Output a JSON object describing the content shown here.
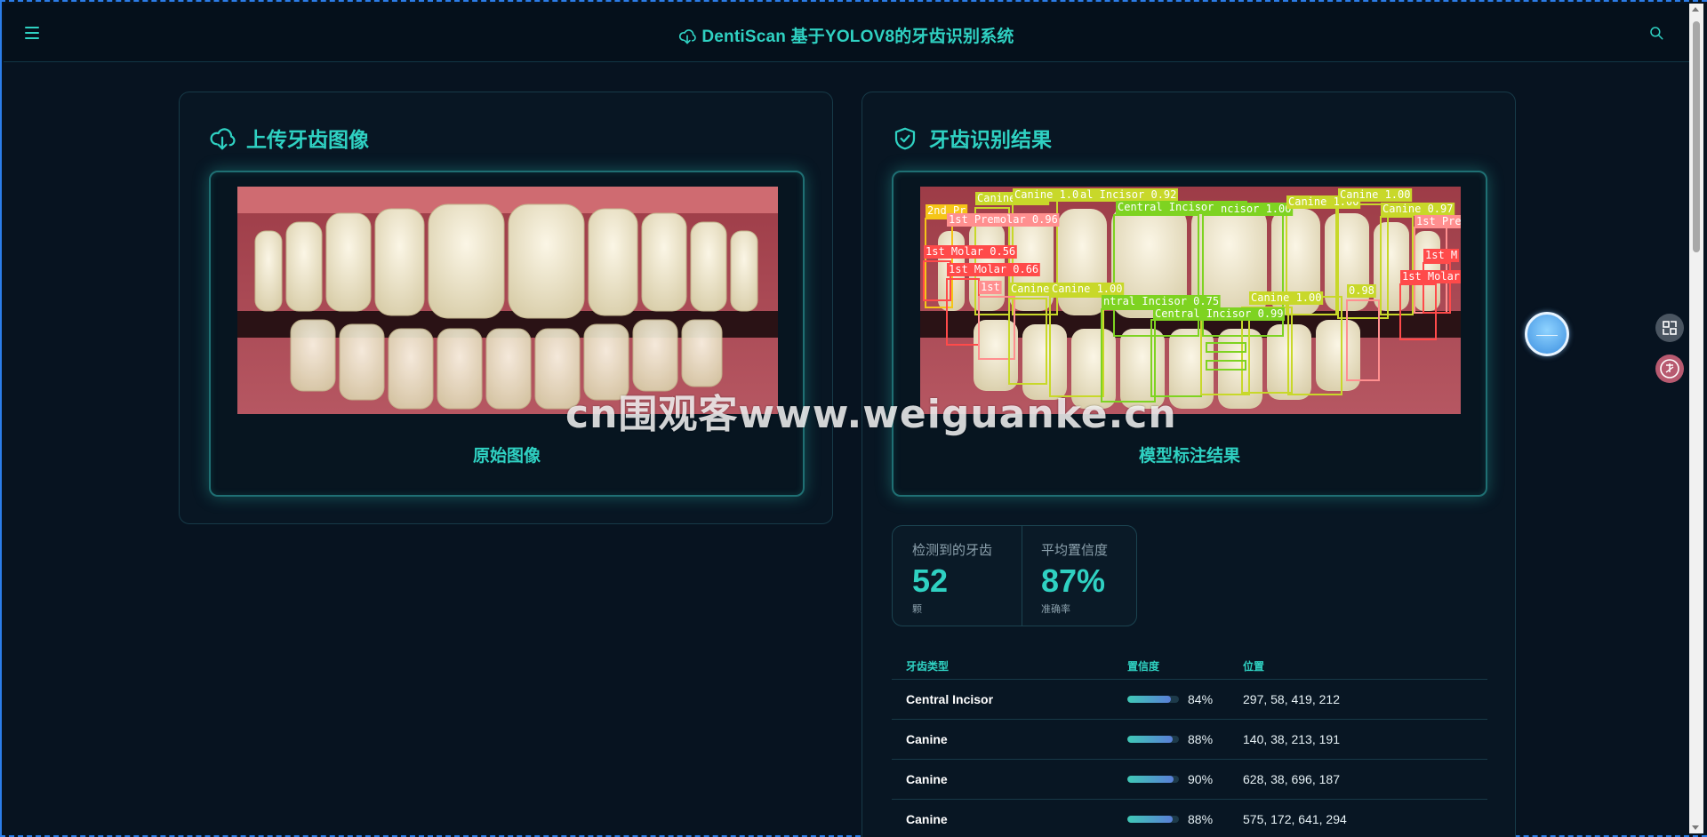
{
  "header": {
    "title": "DentiScan 基于YOLOV8的牙齿识别系统"
  },
  "upload_panel": {
    "title": "上传牙齿图像",
    "caption": "原始图像"
  },
  "result_panel": {
    "title": "牙齿识别结果",
    "caption": "模型标注结果"
  },
  "stats": {
    "detected": {
      "label": "检测到的牙齿",
      "value": "52",
      "unit": "颗"
    },
    "confidence": {
      "label": "平均置信度",
      "value": "87%",
      "unit": "准确率"
    }
  },
  "table": {
    "headers": {
      "type": "牙齿类型",
      "confidence": "置信度",
      "position": "位置"
    },
    "rows": [
      {
        "type": "Central Incisor",
        "confidence": 84,
        "confidence_text": "84%",
        "position": "297, 58, 419, 212"
      },
      {
        "type": "Canine",
        "confidence": 88,
        "confidence_text": "88%",
        "position": "140, 38, 213, 191"
      },
      {
        "type": "Canine",
        "confidence": 90,
        "confidence_text": "90%",
        "position": "628, 38, 696, 187"
      },
      {
        "type": "Canine",
        "confidence": 88,
        "confidence_text": "88%",
        "position": "575, 172, 641, 294"
      }
    ]
  },
  "detection_labels": [
    {
      "text": "2nd Pr",
      "color": "#f5c518"
    },
    {
      "text": "Canine 1.00",
      "color": "#c8d82a"
    },
    {
      "text": "Canine 1.00",
      "color": "#c8d82a"
    },
    {
      "text": "al Incisor 0.92",
      "color": "#c8d82a"
    },
    {
      "text": "1st Premolar 0.96",
      "color": "#ff8f8f"
    },
    {
      "text": "Central Incisor 1.00",
      "color": "#7ed321"
    },
    {
      "text": "ncisor 1.00",
      "color": "#7ed321"
    },
    {
      "text": "Canine 1.00",
      "color": "#c8d82a"
    },
    {
      "text": "Canine 1.00",
      "color": "#c8d82a"
    },
    {
      "text": "Canine 0.97",
      "color": "#c8d82a"
    },
    {
      "text": "1st Pre",
      "color": "#ff8f8f"
    },
    {
      "text": "1st Molar 0.56",
      "color": "#ff4a4a"
    },
    {
      "text": "1st Molar 0.66",
      "color": "#ff4a4a"
    },
    {
      "text": "1st",
      "color": "#ff8f8f"
    },
    {
      "text": "Canine",
      "color": "#c8d82a"
    },
    {
      "text": "Canine 1.00",
      "color": "#c8d82a"
    },
    {
      "text": "ntral Incisor 0.75",
      "color": "#7ed321"
    },
    {
      "text": "Central Incisor 0.99",
      "color": "#7ed321"
    },
    {
      "text": "Canine 1.00",
      "color": "#c8d82a"
    },
    {
      "text": "0.98",
      "color": "#c8d82a"
    },
    {
      "text": "1st M",
      "color": "#ff4a4a"
    },
    {
      "text": "1st Molar",
      "color": "#ff4a4a"
    }
  ],
  "watermark": "cn围观客www.weiguanke.cn",
  "colors": {
    "accent": "#2fd1c2",
    "background": "#071320",
    "panel_border": "#173a48"
  },
  "icons": {
    "menu": "menu-icon",
    "search": "search-icon",
    "upload": "cloud-download-icon",
    "result": "shield-check-icon"
  }
}
